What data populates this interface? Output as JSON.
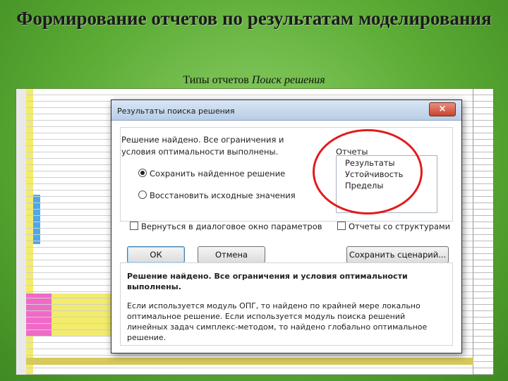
{
  "slide": {
    "title": "Формирование отчетов по результатам моделирования",
    "subtitle_prefix": "Типы отчетов ",
    "subtitle_italic": "Поиск решения"
  },
  "dialog": {
    "title": "Результаты поиска решения",
    "close_label": "×",
    "message": "Решение найдено. Все ограничения и условия оптимальности выполнены.",
    "radio_keep": "Сохранить найденное решение",
    "radio_keep_selected": true,
    "radio_restore": "Восстановить исходные значения",
    "reports_label": "Отчеты",
    "reports": [
      "Результаты",
      "Устойчивость",
      "Пределы"
    ],
    "return_checkbox": "Вернуться в диалоговое окно параметров",
    "outline_checkbox": "Отчеты со структурами",
    "ok_button": "ОК",
    "cancel_button": "Отмена",
    "save_scenario_button": "Сохранить сценарий...",
    "bottom_bold": "Решение найдено. Все ограничения и условия оптимальности выполнены.",
    "bottom_info": "Если используется модуль ОПГ, то найдено по крайней мере локально оптимальное решение. Если используется модуль поиска решений линейных задач симплекс-методом, то найдено глобально оптимальное решение."
  },
  "colors": {
    "background": "#5bab35",
    "highlight_circle": "#e21b1b",
    "sheet_yellow": "#f3ec6b",
    "sheet_magenta": "#f06ac7",
    "sheet_blue": "#4fa8e8"
  }
}
